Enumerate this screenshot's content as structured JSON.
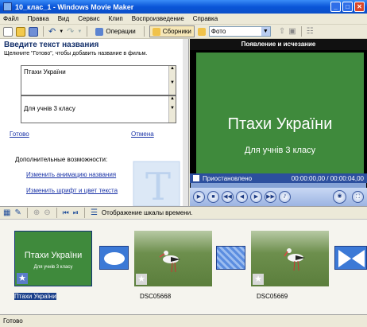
{
  "window": {
    "title": "10_клас_1 - Windows Movie Maker"
  },
  "menu": [
    "Файл",
    "Правка",
    "Вид",
    "Сервис",
    "Клип",
    "Воспроизведение",
    "Справка"
  ],
  "toolbar": {
    "operations_label": "Операции",
    "collections_label": "Сборники",
    "collection_select": "Фото"
  },
  "title_task": {
    "header": "Введите текст названия",
    "hint": "Щелкните \"Готово\", чтобы добавить название в фильм.",
    "line1": "Птахи України",
    "line2": "Для учнів 3 класу",
    "done_label": "Готово",
    "cancel_label": "Отмена",
    "more_options_label": "Дополнительные возможности:",
    "change_animation_label": "Изменить анимацию названия",
    "change_font_label": "Изменить шрифт и цвет текста"
  },
  "preview": {
    "effect_title": "Появление и исчезание",
    "title_text": "Птахи України",
    "subtitle_text": "Для учнів 3 класу",
    "status": "Приостановлено",
    "time": "00:00:00,00 / 00:00:04,00",
    "progress": 0
  },
  "storyboard": {
    "toggle_label": "Отображение шкалы времени.",
    "clips": [
      {
        "name": "Птахи України",
        "thumb_title": "Птахи України",
        "thumb_subtitle": "Для учнів 3 класу",
        "selected": true
      },
      {
        "name": "DSC05668",
        "selected": false
      },
      {
        "name": "DSC05669",
        "selected": false
      }
    ]
  },
  "status_bar": {
    "text": "Готово"
  },
  "colors": {
    "title_bg": "#3f8a3c",
    "link": "#1c35a8",
    "accent": "#0a55d8"
  }
}
